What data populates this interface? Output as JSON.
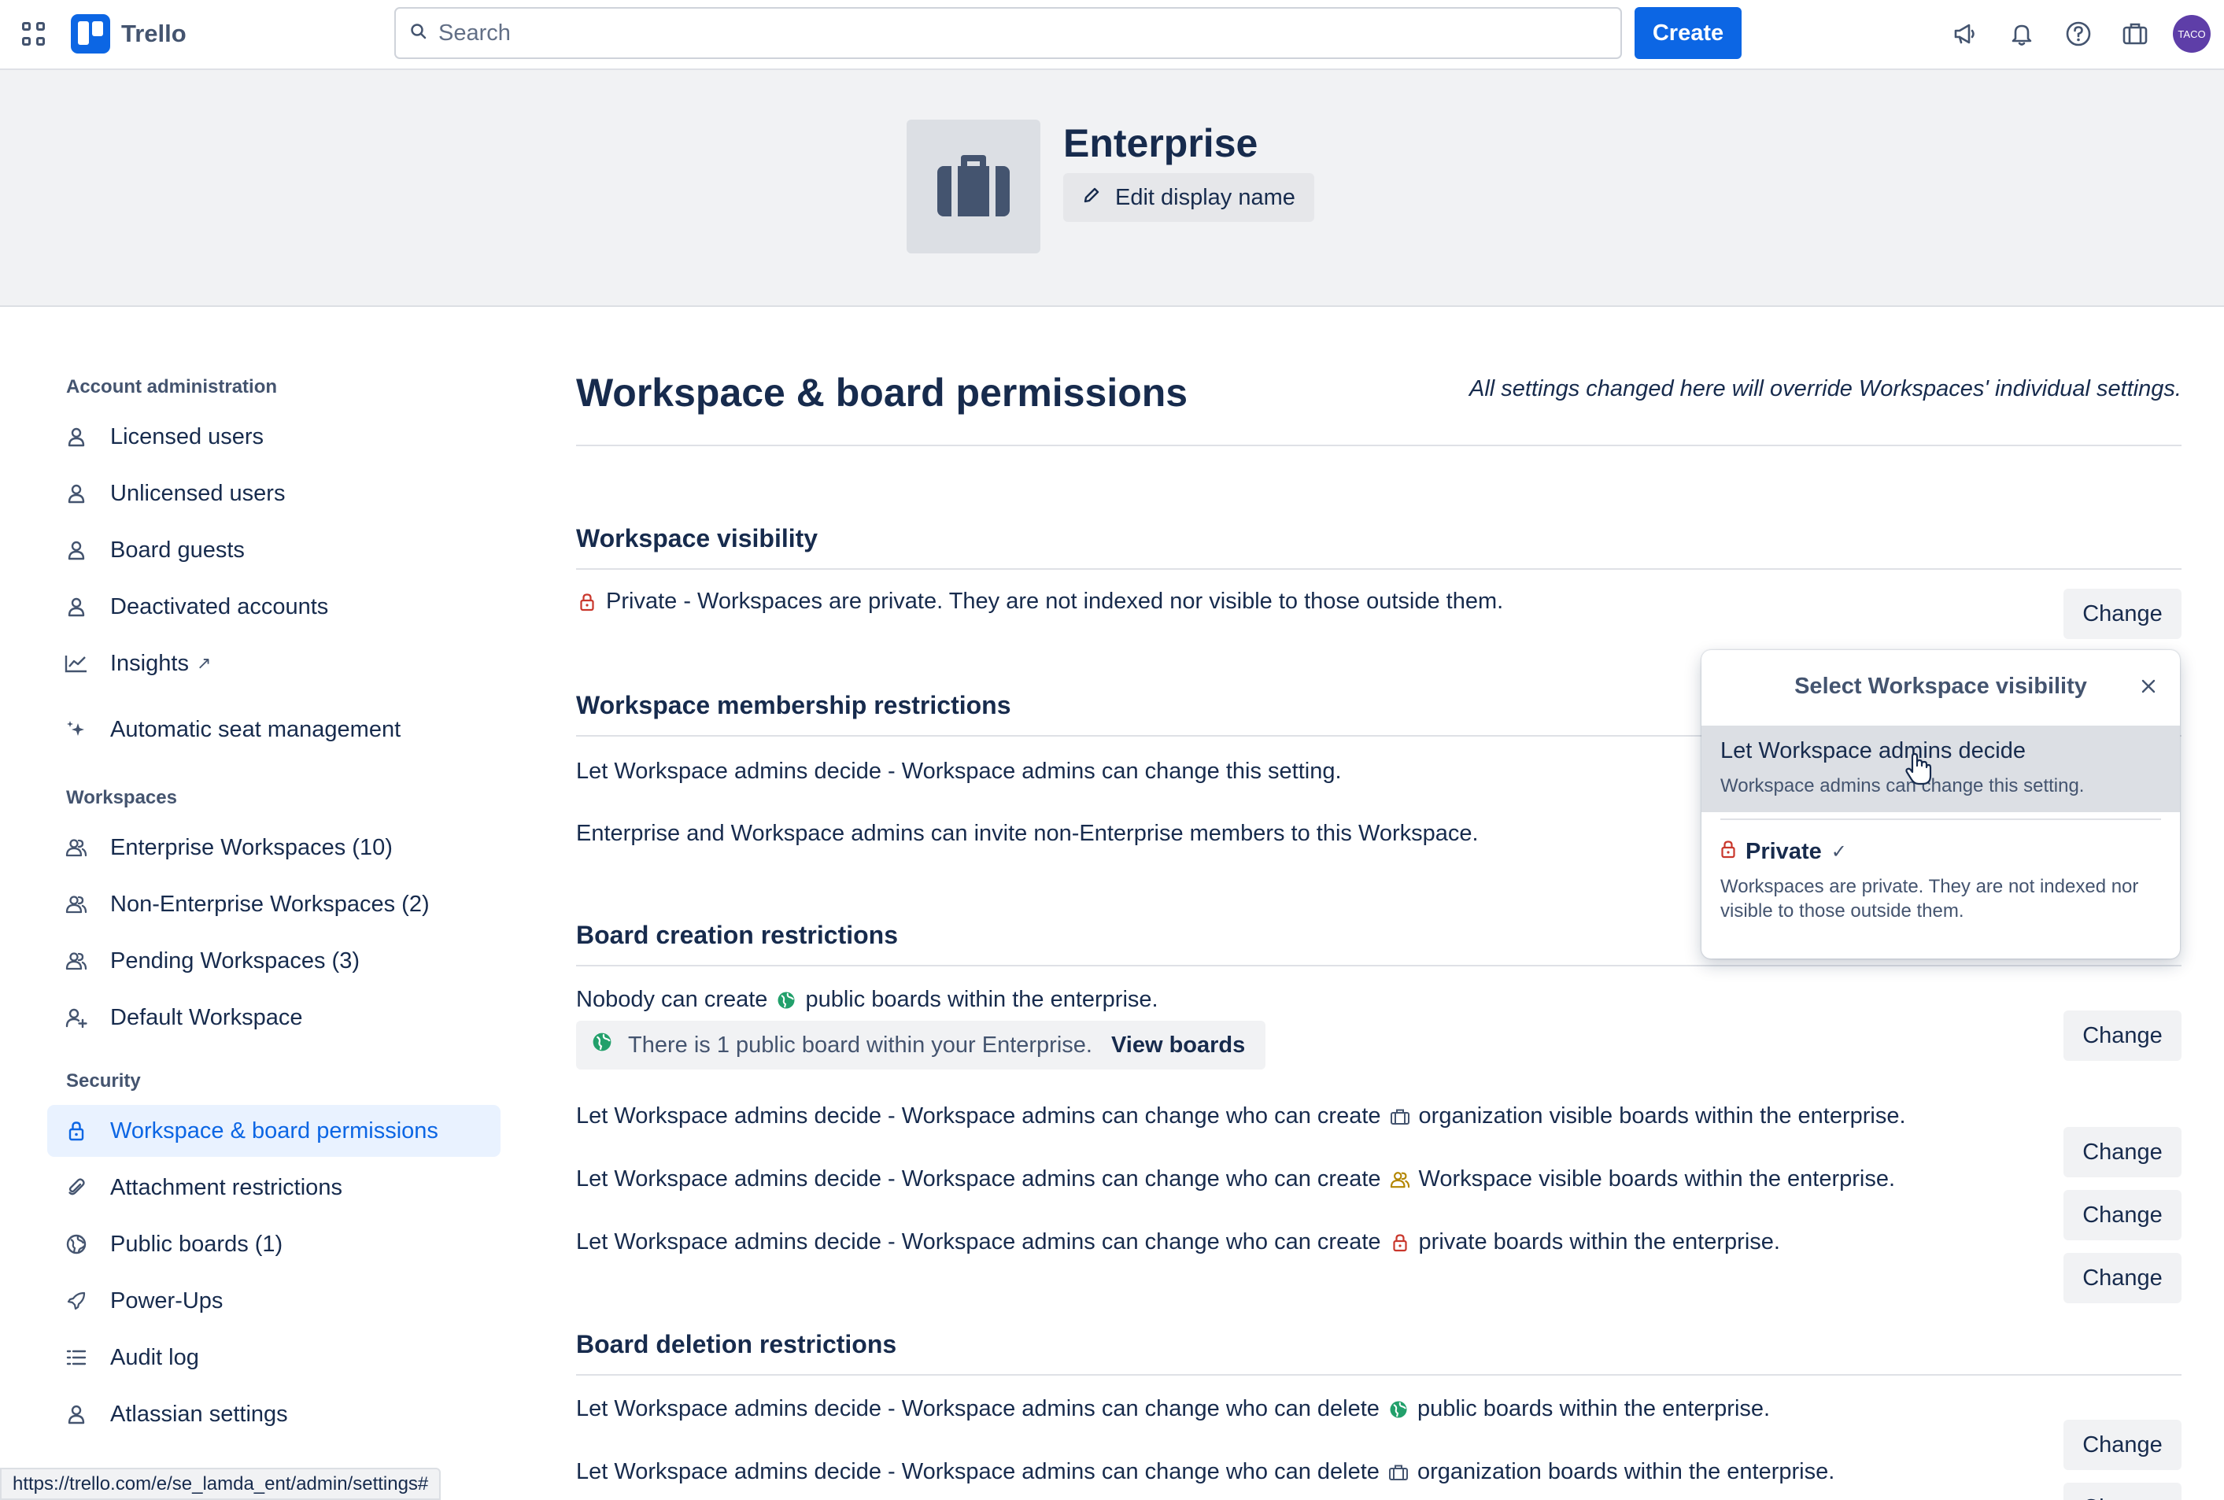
{
  "app": {
    "name": "Trello"
  },
  "topbar": {
    "search_placeholder": "Search",
    "create_label": "Create",
    "avatar_initials": "TACO"
  },
  "header": {
    "enterprise_name": "Enterprise",
    "edit_label": "Edit display name"
  },
  "sidebar": {
    "sections": [
      {
        "heading": "Account administration",
        "items": [
          {
            "label": "Licensed users",
            "icon": "person-icon"
          },
          {
            "label": "Unlicensed users",
            "icon": "person-icon"
          },
          {
            "label": "Board guests",
            "icon": "person-icon"
          },
          {
            "label": "Deactivated accounts",
            "icon": "person-icon"
          },
          {
            "label": "Insights",
            "icon": "chart-line-icon",
            "external": "↗"
          },
          {
            "label": "Automatic seat management",
            "icon": "sparkle-icon"
          }
        ]
      },
      {
        "heading": "Workspaces",
        "items": [
          {
            "label": "Enterprise Workspaces (10)",
            "icon": "people-icon"
          },
          {
            "label": "Non-Enterprise Workspaces (2)",
            "icon": "people-icon"
          },
          {
            "label": "Pending Workspaces (3)",
            "icon": "people-icon"
          },
          {
            "label": "Default Workspace",
            "icon": "person-add-icon"
          }
        ]
      },
      {
        "heading": "Security",
        "items": [
          {
            "label": "Workspace & board permissions",
            "icon": "lock-icon",
            "active": true
          },
          {
            "label": "Attachment restrictions",
            "icon": "paperclip-icon"
          },
          {
            "label": "Public boards (1)",
            "icon": "globe-icon"
          },
          {
            "label": "Power-Ups",
            "icon": "rocket-icon"
          },
          {
            "label": "Audit log",
            "icon": "list-icon"
          },
          {
            "label": "Atlassian settings",
            "icon": "person-icon"
          }
        ]
      }
    ]
  },
  "main": {
    "title": "Workspace & board permissions",
    "override_note": "All settings changed here will override Workspaces' individual settings.",
    "change_label": "Change",
    "visibility": {
      "title": "Workspace visibility",
      "text": "Private - Workspaces are private. They are not indexed nor visible to those outside them."
    },
    "membership": {
      "title": "Workspace membership restrictions",
      "line1": "Let Workspace admins decide - Workspace admins can change this setting.",
      "line2": "Enterprise and Workspace admins can invite non-Enterprise members to this Workspace."
    },
    "creation": {
      "title": "Board creation restrictions",
      "public_pre": "Nobody can create",
      "public_post": "public boards within the enterprise.",
      "info_text": "There is 1 public board within your Enterprise.",
      "info_link": "View boards",
      "org_pre": "Let Workspace admins decide - Workspace admins can change who can create",
      "org_post": "organization visible boards within the enterprise.",
      "ws_pre": "Let Workspace admins decide - Workspace admins can change who can create",
      "ws_post": "Workspace visible boards within the enterprise.",
      "priv_pre": "Let Workspace admins decide - Workspace admins can change who can create",
      "priv_post": "private boards within the enterprise."
    },
    "deletion": {
      "title": "Board deletion restrictions",
      "public_pre": "Let Workspace admins decide - Workspace admins can change who can delete",
      "public_post": "public boards within the enterprise.",
      "org_pre": "Let Workspace admins decide - Workspace admins can change who can delete",
      "org_post": "organization boards within the enterprise."
    }
  },
  "popover": {
    "title": "Select Workspace visibility",
    "option1_title": "Let Workspace admins decide",
    "option1_desc": "Workspace admins can change this setting.",
    "option2_title": "Private",
    "option2_check": "✓",
    "option2_desc": "Workspaces are private. They are not indexed nor visible to those outside them."
  },
  "status_url": "https://trello.com/e/se_lamda_ent/admin/settings#",
  "colors": {
    "brand": "#0c66e4",
    "active_bg": "#e9f2ff",
    "lock_red": "#c9372c",
    "globe_green": "#22a06b",
    "people_yellow": "#b38600"
  }
}
